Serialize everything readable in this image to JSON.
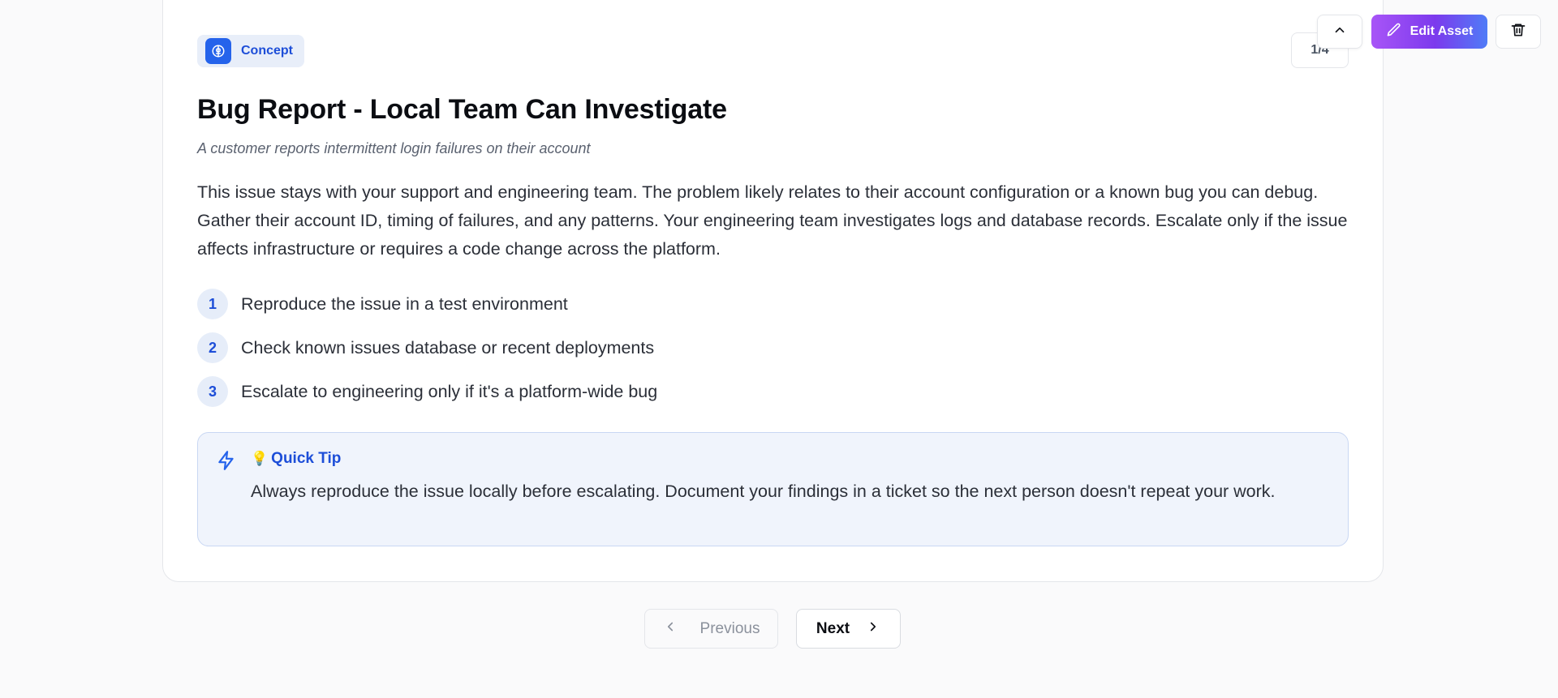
{
  "badge": {
    "label": "Concept",
    "icon": "brain-icon"
  },
  "counter": "1/4",
  "toolbar": {
    "collapse_icon": "chevron-up-icon",
    "edit_label": "Edit Asset",
    "edit_icon": "pencil-icon",
    "delete_icon": "trash-icon"
  },
  "content": {
    "title": "Bug Report - Local Team Can Investigate",
    "subtitle": "A customer reports intermittent login failures on their account",
    "body": "This issue stays with your support and engineering team. The problem likely relates to their account configuration or a known bug you can debug. Gather their account ID, timing of failures, and any patterns. Your engineering team investigates logs and database records. Escalate only if the issue affects infrastructure or requires a code change across the platform.",
    "steps": [
      {
        "num": "1",
        "text": "Reproduce the issue in a test environment"
      },
      {
        "num": "2",
        "text": "Check known issues database or recent deployments"
      },
      {
        "num": "3",
        "text": "Escalate to engineering only if it's a platform-wide bug"
      }
    ]
  },
  "tip": {
    "icon": "lightning-icon",
    "emoji": "💡",
    "heading": "Quick Tip",
    "text": "Always reproduce the issue locally before escalating. Document your findings in a ticket so the next person doesn't repeat your work."
  },
  "pagination": {
    "previous_label": "Previous",
    "next_label": "Next"
  },
  "colors": {
    "accent": "#2563eb",
    "edit_gradient_start": "#a855f7",
    "edit_gradient_end": "#4f7cf7",
    "tip_background": "#f0f4fc"
  }
}
